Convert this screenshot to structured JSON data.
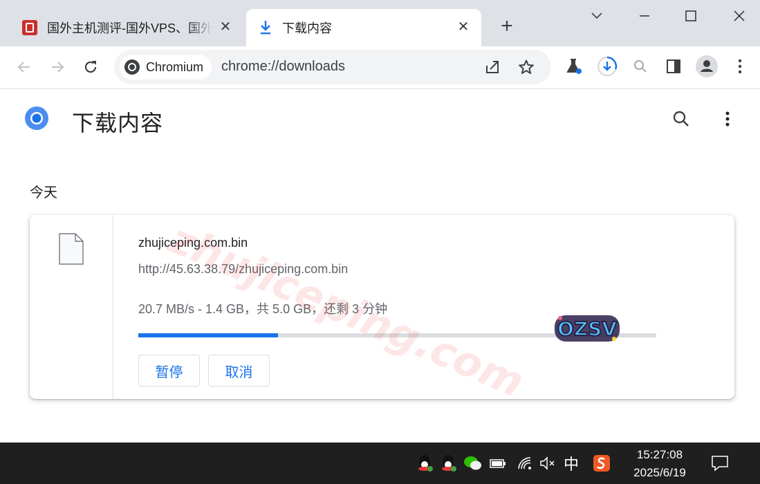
{
  "tabs": [
    {
      "title": "国外主机测评-国外VPS、国外",
      "close": "✕",
      "active": false
    },
    {
      "title": "下载内容",
      "close": "✕",
      "active": true
    }
  ],
  "newtab_label": "+",
  "omnibox": {
    "chip_label": "Chromium",
    "url": "chrome://downloads"
  },
  "page": {
    "title": "下载内容",
    "section": "今天"
  },
  "download": {
    "file_name": "zhujiceping.com.bin",
    "file_url": "http://45.63.38.79/zhujiceping.com.bin",
    "status": "20.7 MB/s - 1.4 GB，共 5.0 GB，还剩 3 分钟",
    "progress_fraction": 0.27,
    "pause_label": "暂停",
    "cancel_label": "取消"
  },
  "watermark": {
    "text": "zhujiceping.com",
    "logo_text": "OZSV"
  },
  "taskbar": {
    "ime_label": "中",
    "time": "15:27:08",
    "date": "2025/6/19"
  },
  "colors": {
    "accent": "#1a73e8",
    "tabstrip": "#dee1e6",
    "taskbar": "#1f1f1f"
  }
}
